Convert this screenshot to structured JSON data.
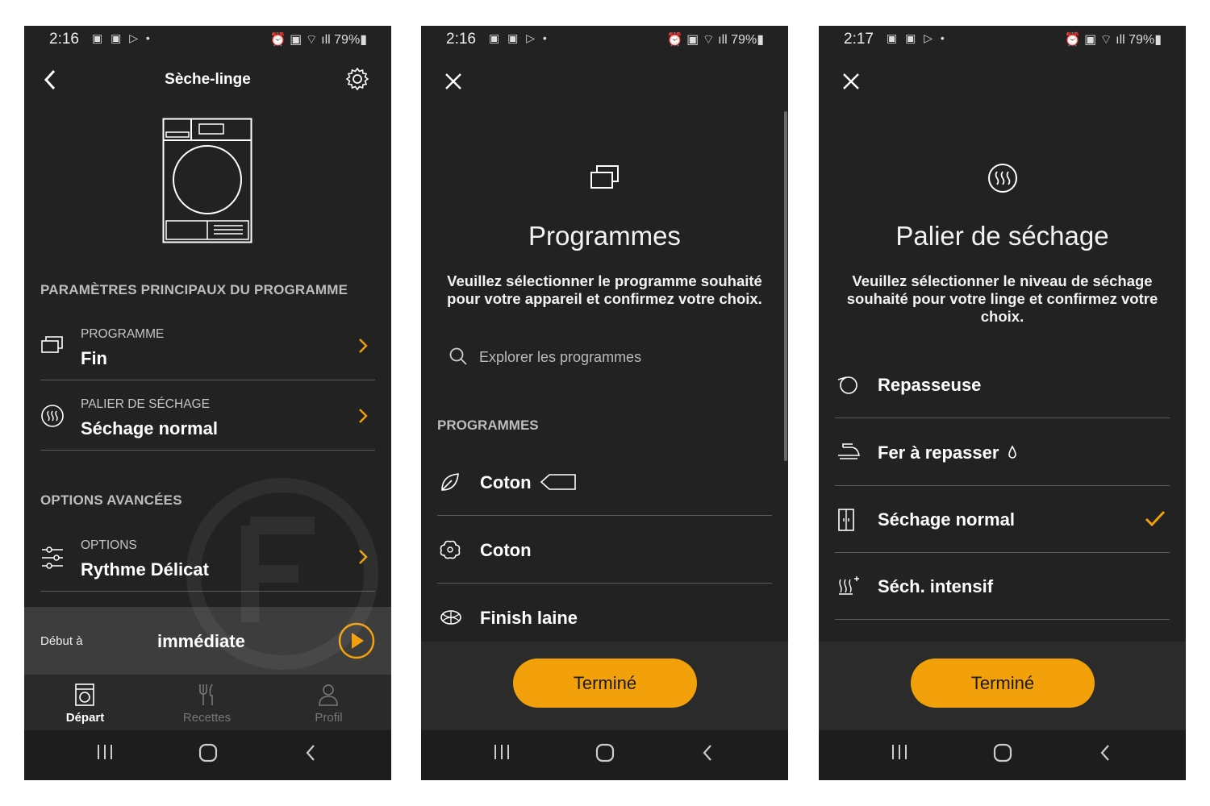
{
  "status": {
    "screen1_time": "2:16",
    "screen2_time": "2:16",
    "screen3_time": "2:17",
    "battery": "79%"
  },
  "screen1": {
    "title": "Sèche-linge",
    "main_params_header": "PARAMÈTRES PRINCIPAUX DU PROGRAMME",
    "program": {
      "label": "PROGRAMME",
      "value": "Fin"
    },
    "drying_level": {
      "label": "PALIER DE SÉCHAGE",
      "value": "Séchage normal"
    },
    "advanced_header": "OPTIONS AVANCÉES",
    "options": {
      "label": "OPTIONS",
      "value": "Rythme Délicat"
    },
    "start": {
      "label": "Début à",
      "value": "immédiate"
    },
    "tabs": [
      {
        "label": "Départ",
        "active": true
      },
      {
        "label": "Recettes",
        "active": false
      },
      {
        "label": "Profil",
        "active": false
      }
    ]
  },
  "screen2": {
    "title": "Programmes",
    "description": "Veuillez sélectionner le programme souhaité pour votre appareil et confirmez votre choix.",
    "search_placeholder": "Explorer les programmes",
    "list_header": "PROGRAMMES",
    "items": [
      "Coton",
      "Coton",
      "Finish laine"
    ],
    "done_label": "Terminé"
  },
  "screen3": {
    "title": "Palier de séchage",
    "description": "Veuillez sélectionner le niveau de séchage souhaité pour votre linge et confirmez votre choix.",
    "items": [
      {
        "label": "Repasseuse",
        "selected": false
      },
      {
        "label": "Fer à repasser",
        "selected": false
      },
      {
        "label": "Séchage normal",
        "selected": true
      },
      {
        "label": "Séch. intensif",
        "selected": false
      }
    ],
    "done_label": "Terminé"
  },
  "colors": {
    "accent": "#f3a10a",
    "background": "#222222"
  }
}
